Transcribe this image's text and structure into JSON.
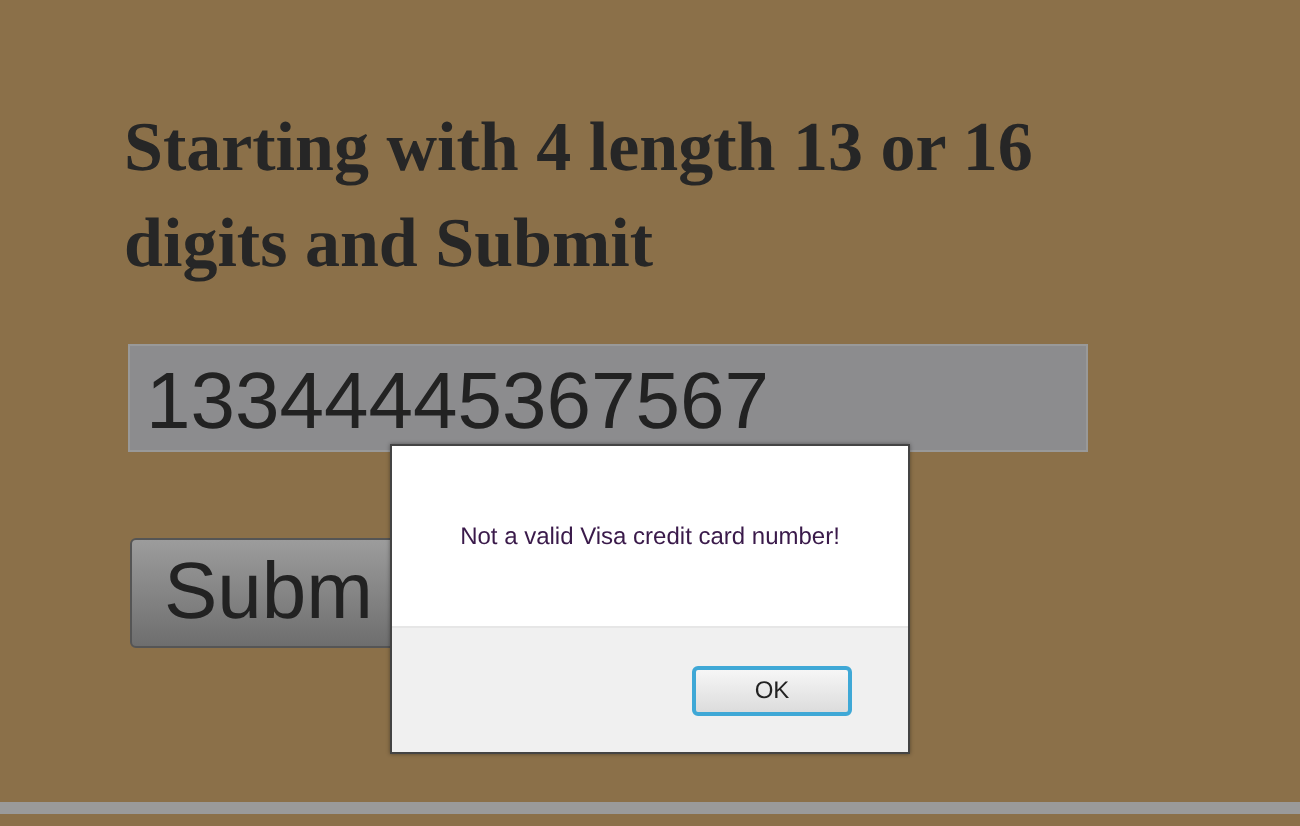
{
  "heading": "Starting with 4 length 13 or 16 digits and Submit",
  "card_field": {
    "value": "13344445367567"
  },
  "submit_button": {
    "label": "Subm"
  },
  "alert": {
    "message": "Not a valid Visa credit card number!",
    "button": "OK"
  }
}
